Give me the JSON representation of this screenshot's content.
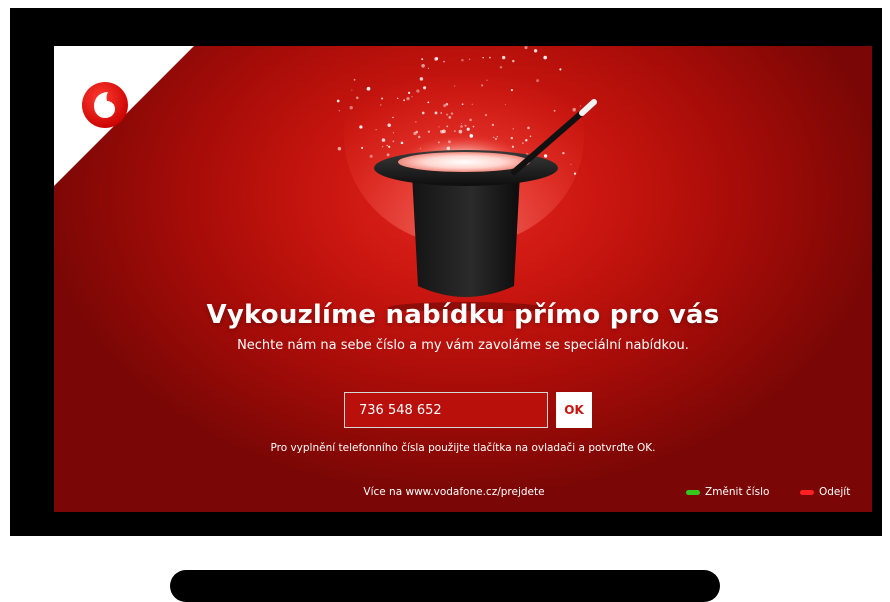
{
  "brand": {
    "logo_icon": "vodafone-speechmark-icon",
    "red": "#e60000",
    "dark_red": "#a70c08"
  },
  "hero": {
    "hat_icon": "magic-top-hat-icon",
    "wand_icon": "magic-wand-icon"
  },
  "offer": {
    "headline": "Vykouzlíme nabídku přímo pro vás",
    "subline": "Nechte nám na sebe číslo a my vám zavoláme se speciální nabídkou."
  },
  "form": {
    "phone_value": "736 548 652",
    "ok_label": "OK",
    "hint": "Pro vyplnění telefonního čísla použijte tlačítka na ovladači a potvrďte OK."
  },
  "footer": {
    "url_text": "Více na www.vodafone.cz/prejdete",
    "actions": [
      {
        "label": "Změnit číslo",
        "color": "#35c81c"
      },
      {
        "label": "Odejít",
        "color": "#ff2020"
      }
    ]
  }
}
